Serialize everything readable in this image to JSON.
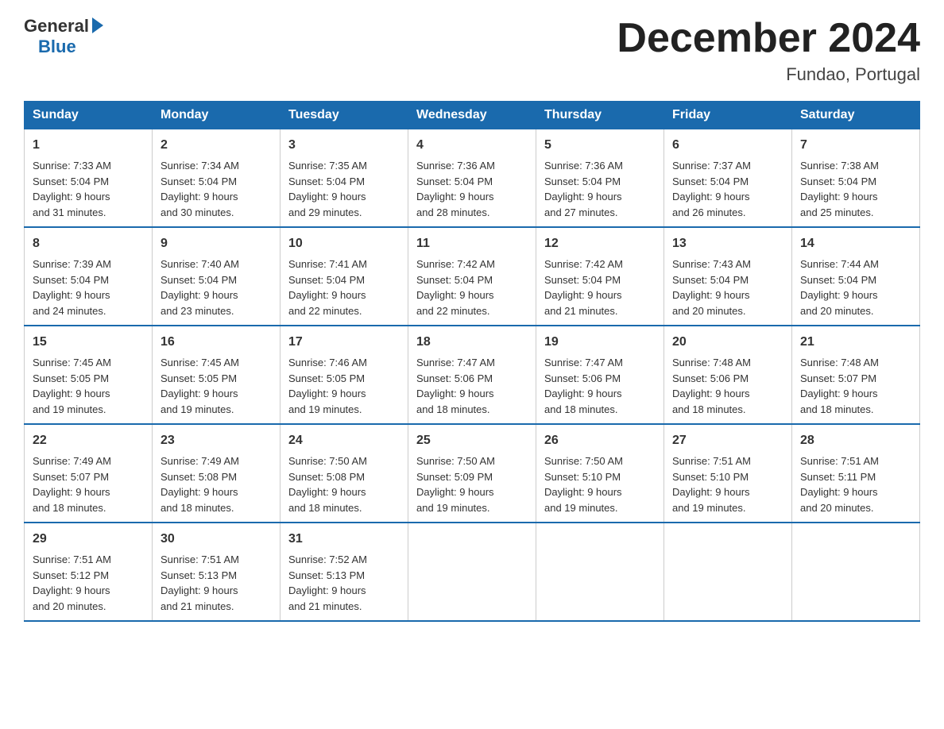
{
  "logo": {
    "general": "General",
    "blue": "Blue"
  },
  "title": "December 2024",
  "subtitle": "Fundao, Portugal",
  "headers": [
    "Sunday",
    "Monday",
    "Tuesday",
    "Wednesday",
    "Thursday",
    "Friday",
    "Saturday"
  ],
  "weeks": [
    [
      {
        "day": "1",
        "sunrise": "Sunrise: 7:33 AM",
        "sunset": "Sunset: 5:04 PM",
        "daylight": "Daylight: 9 hours",
        "daylight2": "and 31 minutes."
      },
      {
        "day": "2",
        "sunrise": "Sunrise: 7:34 AM",
        "sunset": "Sunset: 5:04 PM",
        "daylight": "Daylight: 9 hours",
        "daylight2": "and 30 minutes."
      },
      {
        "day": "3",
        "sunrise": "Sunrise: 7:35 AM",
        "sunset": "Sunset: 5:04 PM",
        "daylight": "Daylight: 9 hours",
        "daylight2": "and 29 minutes."
      },
      {
        "day": "4",
        "sunrise": "Sunrise: 7:36 AM",
        "sunset": "Sunset: 5:04 PM",
        "daylight": "Daylight: 9 hours",
        "daylight2": "and 28 minutes."
      },
      {
        "day": "5",
        "sunrise": "Sunrise: 7:36 AM",
        "sunset": "Sunset: 5:04 PM",
        "daylight": "Daylight: 9 hours",
        "daylight2": "and 27 minutes."
      },
      {
        "day": "6",
        "sunrise": "Sunrise: 7:37 AM",
        "sunset": "Sunset: 5:04 PM",
        "daylight": "Daylight: 9 hours",
        "daylight2": "and 26 minutes."
      },
      {
        "day": "7",
        "sunrise": "Sunrise: 7:38 AM",
        "sunset": "Sunset: 5:04 PM",
        "daylight": "Daylight: 9 hours",
        "daylight2": "and 25 minutes."
      }
    ],
    [
      {
        "day": "8",
        "sunrise": "Sunrise: 7:39 AM",
        "sunset": "Sunset: 5:04 PM",
        "daylight": "Daylight: 9 hours",
        "daylight2": "and 24 minutes."
      },
      {
        "day": "9",
        "sunrise": "Sunrise: 7:40 AM",
        "sunset": "Sunset: 5:04 PM",
        "daylight": "Daylight: 9 hours",
        "daylight2": "and 23 minutes."
      },
      {
        "day": "10",
        "sunrise": "Sunrise: 7:41 AM",
        "sunset": "Sunset: 5:04 PM",
        "daylight": "Daylight: 9 hours",
        "daylight2": "and 22 minutes."
      },
      {
        "day": "11",
        "sunrise": "Sunrise: 7:42 AM",
        "sunset": "Sunset: 5:04 PM",
        "daylight": "Daylight: 9 hours",
        "daylight2": "and 22 minutes."
      },
      {
        "day": "12",
        "sunrise": "Sunrise: 7:42 AM",
        "sunset": "Sunset: 5:04 PM",
        "daylight": "Daylight: 9 hours",
        "daylight2": "and 21 minutes."
      },
      {
        "day": "13",
        "sunrise": "Sunrise: 7:43 AM",
        "sunset": "Sunset: 5:04 PM",
        "daylight": "Daylight: 9 hours",
        "daylight2": "and 20 minutes."
      },
      {
        "day": "14",
        "sunrise": "Sunrise: 7:44 AM",
        "sunset": "Sunset: 5:04 PM",
        "daylight": "Daylight: 9 hours",
        "daylight2": "and 20 minutes."
      }
    ],
    [
      {
        "day": "15",
        "sunrise": "Sunrise: 7:45 AM",
        "sunset": "Sunset: 5:05 PM",
        "daylight": "Daylight: 9 hours",
        "daylight2": "and 19 minutes."
      },
      {
        "day": "16",
        "sunrise": "Sunrise: 7:45 AM",
        "sunset": "Sunset: 5:05 PM",
        "daylight": "Daylight: 9 hours",
        "daylight2": "and 19 minutes."
      },
      {
        "day": "17",
        "sunrise": "Sunrise: 7:46 AM",
        "sunset": "Sunset: 5:05 PM",
        "daylight": "Daylight: 9 hours",
        "daylight2": "and 19 minutes."
      },
      {
        "day": "18",
        "sunrise": "Sunrise: 7:47 AM",
        "sunset": "Sunset: 5:06 PM",
        "daylight": "Daylight: 9 hours",
        "daylight2": "and 18 minutes."
      },
      {
        "day": "19",
        "sunrise": "Sunrise: 7:47 AM",
        "sunset": "Sunset: 5:06 PM",
        "daylight": "Daylight: 9 hours",
        "daylight2": "and 18 minutes."
      },
      {
        "day": "20",
        "sunrise": "Sunrise: 7:48 AM",
        "sunset": "Sunset: 5:06 PM",
        "daylight": "Daylight: 9 hours",
        "daylight2": "and 18 minutes."
      },
      {
        "day": "21",
        "sunrise": "Sunrise: 7:48 AM",
        "sunset": "Sunset: 5:07 PM",
        "daylight": "Daylight: 9 hours",
        "daylight2": "and 18 minutes."
      }
    ],
    [
      {
        "day": "22",
        "sunrise": "Sunrise: 7:49 AM",
        "sunset": "Sunset: 5:07 PM",
        "daylight": "Daylight: 9 hours",
        "daylight2": "and 18 minutes."
      },
      {
        "day": "23",
        "sunrise": "Sunrise: 7:49 AM",
        "sunset": "Sunset: 5:08 PM",
        "daylight": "Daylight: 9 hours",
        "daylight2": "and 18 minutes."
      },
      {
        "day": "24",
        "sunrise": "Sunrise: 7:50 AM",
        "sunset": "Sunset: 5:08 PM",
        "daylight": "Daylight: 9 hours",
        "daylight2": "and 18 minutes."
      },
      {
        "day": "25",
        "sunrise": "Sunrise: 7:50 AM",
        "sunset": "Sunset: 5:09 PM",
        "daylight": "Daylight: 9 hours",
        "daylight2": "and 19 minutes."
      },
      {
        "day": "26",
        "sunrise": "Sunrise: 7:50 AM",
        "sunset": "Sunset: 5:10 PM",
        "daylight": "Daylight: 9 hours",
        "daylight2": "and 19 minutes."
      },
      {
        "day": "27",
        "sunrise": "Sunrise: 7:51 AM",
        "sunset": "Sunset: 5:10 PM",
        "daylight": "Daylight: 9 hours",
        "daylight2": "and 19 minutes."
      },
      {
        "day": "28",
        "sunrise": "Sunrise: 7:51 AM",
        "sunset": "Sunset: 5:11 PM",
        "daylight": "Daylight: 9 hours",
        "daylight2": "and 20 minutes."
      }
    ],
    [
      {
        "day": "29",
        "sunrise": "Sunrise: 7:51 AM",
        "sunset": "Sunset: 5:12 PM",
        "daylight": "Daylight: 9 hours",
        "daylight2": "and 20 minutes."
      },
      {
        "day": "30",
        "sunrise": "Sunrise: 7:51 AM",
        "sunset": "Sunset: 5:13 PM",
        "daylight": "Daylight: 9 hours",
        "daylight2": "and 21 minutes."
      },
      {
        "day": "31",
        "sunrise": "Sunrise: 7:52 AM",
        "sunset": "Sunset: 5:13 PM",
        "daylight": "Daylight: 9 hours",
        "daylight2": "and 21 minutes."
      },
      null,
      null,
      null,
      null
    ]
  ]
}
